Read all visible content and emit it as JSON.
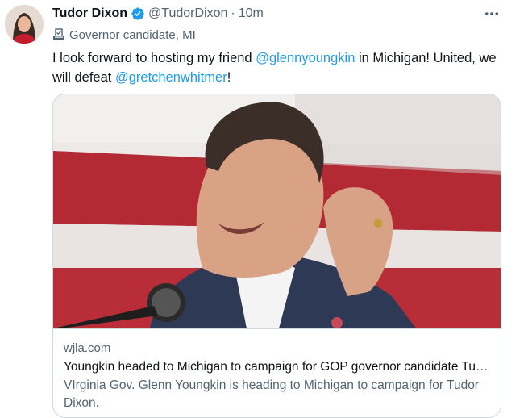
{
  "tweet": {
    "author_name": "Tudor Dixon",
    "handle": "@TudorDixon",
    "separator": "·",
    "time": "10m",
    "label": "Governor candidate, MI",
    "text_1": "I look forward to hosting my friend ",
    "mention_1": "@glennyoungkin",
    "text_2": " in Michigan! United, we will defeat ",
    "mention_2": "@gretchenwhitmer",
    "text_3": "!"
  },
  "card": {
    "domain": "wjla.com",
    "title": "Youngkin headed to Michigan to campaign for GOP governor candidate Tudor Dixon",
    "description": "VIrginia Gov. Glenn Youngkin is heading to Michigan to campaign for Tudor Dixon."
  },
  "colors": {
    "link": "#1d9bf0",
    "verified": "#1d9bf0",
    "secondary_text": "#536471",
    "border": "#cfd9de"
  },
  "icons": {
    "verified": "verified-badge-icon",
    "more": "more-options-icon",
    "label": "government-label-icon"
  }
}
